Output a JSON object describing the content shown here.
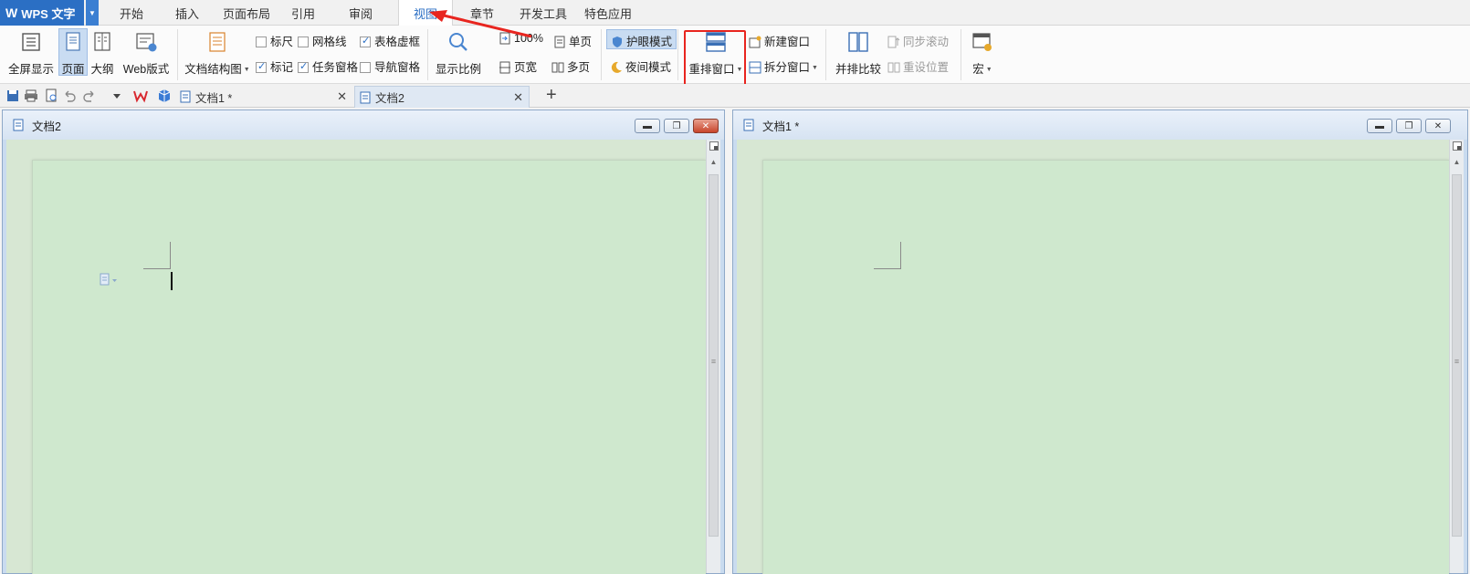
{
  "app": {
    "name": "WPS 文字",
    "logo_letter": "W"
  },
  "menu_tabs": [
    "开始",
    "插入",
    "页面布局",
    "引用",
    "审阅",
    "视图",
    "章节",
    "开发工具",
    "特色应用"
  ],
  "active_tab": "视图",
  "ribbon": {
    "fullscreen": "全屏显示",
    "page": "页面",
    "outline": "大纲",
    "web_layout": "Web版式",
    "doc_map": "文档结构图",
    "ruler": "标尺",
    "gridlines": "网格线",
    "table_gridlines": "表格虚框",
    "markup": "标记",
    "task_pane": "任务窗格",
    "nav_pane": "导航窗格",
    "zoom": "显示比例",
    "zoom_100": "100%",
    "page_width": "页宽",
    "one_page": "单页",
    "multi_page": "多页",
    "eye_mode": "护眼模式",
    "night_mode": "夜间模式",
    "arrange_windows": "重排窗口",
    "new_window": "新建窗口",
    "split_window": "拆分窗口",
    "side_by_side": "并排比较",
    "sync_scroll": "同步滚动",
    "reset_position": "重设位置",
    "macro": "宏"
  },
  "checkboxes": {
    "ruler": false,
    "gridlines": false,
    "table_gridlines": true,
    "markup": true,
    "task_pane": true,
    "nav_pane": false
  },
  "doc_tabs": [
    {
      "title": "文档1 *",
      "active": false
    },
    {
      "title": "文档2",
      "active": true
    }
  ],
  "windows": {
    "left_title": "文档2",
    "right_title": "文档1 *"
  },
  "colors": {
    "accent": "#2b6fc4",
    "page_green": "#cfe8ce",
    "highlight_red": "#e8251f"
  }
}
